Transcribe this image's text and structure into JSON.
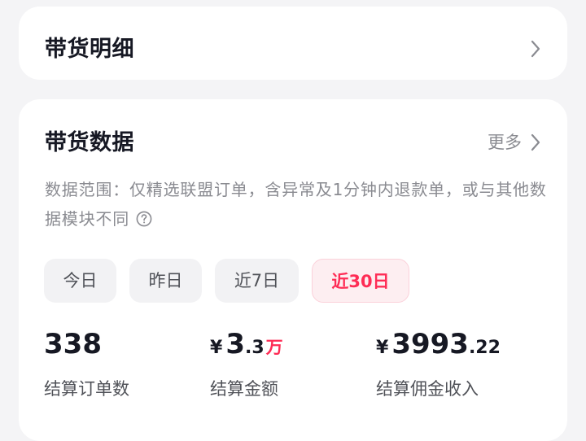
{
  "detail_card": {
    "title": "带货明细",
    "chevron_icon": "chevron-right-icon"
  },
  "data_card": {
    "title": "带货数据",
    "more_label": "更多",
    "description": "数据范围：仅精选联盟订单，含异常及1分钟内退款单，或与其他数据模块不同",
    "help_icon": "help-circle-icon",
    "tabs": [
      {
        "label": "今日",
        "active": false
      },
      {
        "label": "昨日",
        "active": false
      },
      {
        "label": "近7日",
        "active": false
      },
      {
        "label": "近30日",
        "active": true
      }
    ],
    "stats": [
      {
        "value": "338",
        "label": "结算订单数"
      },
      {
        "currency": "¥",
        "value_int": "3",
        "value_dec": ".3",
        "unit": "万",
        "label": "结算金额"
      },
      {
        "currency": "¥",
        "value_int": "3993",
        "value_dec": ".22",
        "label": "结算佣金收入"
      }
    ]
  },
  "colors": {
    "accent": "#fe2c55",
    "text_primary": "#161823",
    "text_secondary": "#8a8b91",
    "page_background": "#f4f4f6"
  }
}
